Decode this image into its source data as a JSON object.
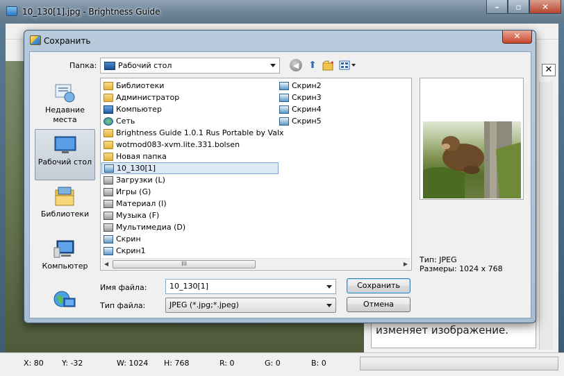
{
  "main_window": {
    "title": "10_130[1].jpg - Brightness Guide",
    "help_text": "изменяет изображение.",
    "status": {
      "x": "X: 80",
      "y": "Y: -32",
      "w": "W: 1024",
      "h": "H: 768",
      "r": "R: 0",
      "g": "G: 0",
      "b": "B: 0"
    }
  },
  "dialog": {
    "title": "Сохранить",
    "folder_label": "Папка:",
    "folder_value": "Рабочий стол",
    "places": [
      {
        "label": "Недавние места",
        "icon": "recent-places-icon"
      },
      {
        "label": "Рабочий стол",
        "icon": "desktop-icon"
      },
      {
        "label": "Библиотеки",
        "icon": "libraries-icon"
      },
      {
        "label": "Компьютер",
        "icon": "computer-icon"
      },
      {
        "label": "",
        "icon": "network-icon"
      }
    ],
    "files_col1": [
      {
        "name": "Библиотеки",
        "icon": "folder-icon"
      },
      {
        "name": "Администратор",
        "icon": "folder-icon"
      },
      {
        "name": "Компьютер",
        "icon": "computer-icon"
      },
      {
        "name": "Сеть",
        "icon": "network-icon"
      },
      {
        "name": "Brightness Guide 1.0.1 Rus Portable by Valx",
        "icon": "folder-icon"
      },
      {
        "name": "wotmod083-xvm.lite.331.bolsen",
        "icon": "folder-icon"
      },
      {
        "name": "Новая папка",
        "icon": "folder-icon"
      },
      {
        "name": "10_130[1]",
        "icon": "image-file-icon",
        "selected": true
      },
      {
        "name": "Загрузки (L)",
        "icon": "drive-icon"
      },
      {
        "name": "Игры (G)",
        "icon": "drive-icon"
      },
      {
        "name": "Материал (I)",
        "icon": "drive-icon"
      },
      {
        "name": "Музыка (F)",
        "icon": "drive-icon"
      },
      {
        "name": "Мультимедиа (D)",
        "icon": "drive-icon"
      },
      {
        "name": "Скрин",
        "icon": "image-file-icon"
      },
      {
        "name": "Скрин1",
        "icon": "image-file-icon"
      }
    ],
    "files_col2": [
      {
        "name": "Скрин2",
        "icon": "image-file-icon"
      },
      {
        "name": "Скрин3",
        "icon": "image-file-icon"
      },
      {
        "name": "Скрин4",
        "icon": "image-file-icon"
      },
      {
        "name": "Скрин5",
        "icon": "image-file-icon"
      }
    ],
    "preview": {
      "type_line": "Тип: JPEG",
      "size_line": "Размеры: 1024 x 768"
    },
    "filename_label": "Имя файла:",
    "filename_value": "10_130[1]",
    "filetype_label": "Тип файла:",
    "filetype_value": "JPEG (*.jpg;*.jpeg)",
    "save_label": "Сохранить",
    "cancel_label": "Отмена",
    "scroll_thumb": "III"
  }
}
